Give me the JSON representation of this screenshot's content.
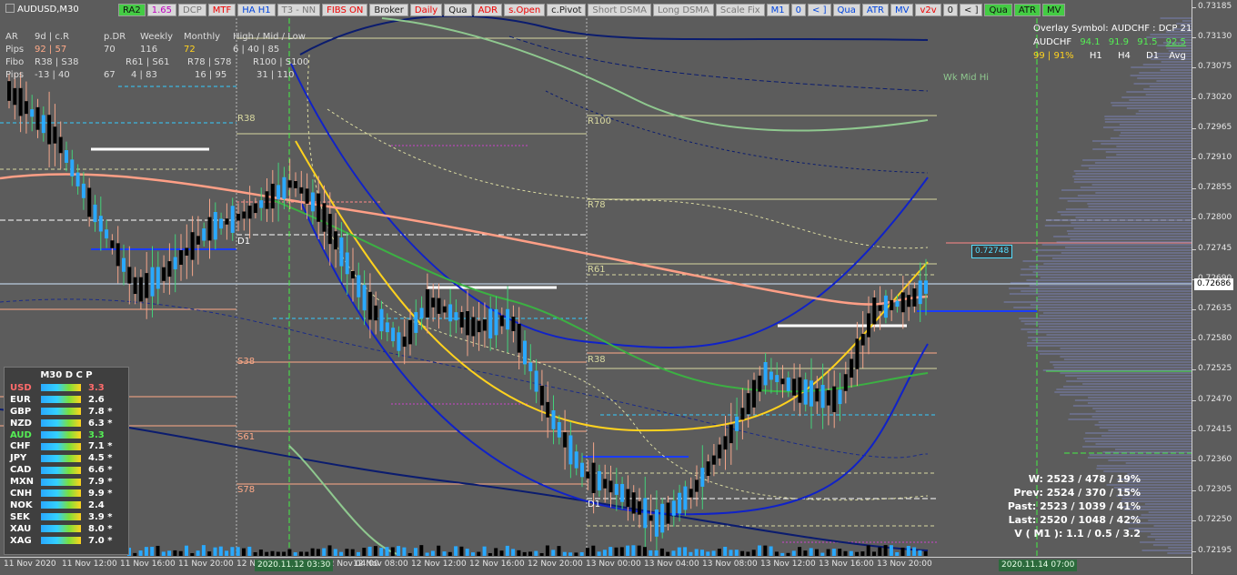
{
  "symbol": "AUDUSD,M30",
  "toolbar": [
    {
      "label": "RA2",
      "cls": "green"
    },
    {
      "label": "1.65",
      "cls": "magenta"
    },
    {
      "label": "DCP",
      "cls": "gray"
    },
    {
      "label": "MTF",
      "cls": "red"
    },
    {
      "label": "HA H1",
      "cls": "blue"
    },
    {
      "label": "T3 - NN",
      "cls": "gray"
    },
    {
      "label": "FIBS ON",
      "cls": "red"
    },
    {
      "label": "Broker",
      "cls": ""
    },
    {
      "label": "Daily",
      "cls": "red"
    },
    {
      "label": "Qua",
      "cls": ""
    },
    {
      "label": "ADR",
      "cls": "red"
    },
    {
      "label": "s.Open",
      "cls": "red"
    },
    {
      "label": "c.Pivot",
      "cls": ""
    },
    {
      "label": "Short DSMA",
      "cls": "gray"
    },
    {
      "label": "Long DSMA",
      "cls": "gray"
    },
    {
      "label": "Scale Fix",
      "cls": "gray"
    },
    {
      "label": "M1",
      "cls": "blue"
    },
    {
      "label": "0",
      "cls": "blue"
    },
    {
      "label": "< ]",
      "cls": "blue"
    },
    {
      "label": "Qua",
      "cls": "blue"
    },
    {
      "label": "ATR",
      "cls": "blue"
    },
    {
      "label": "MV",
      "cls": "blue"
    },
    {
      "label": "v2v",
      "cls": "red"
    },
    {
      "label": "0",
      "cls": ""
    },
    {
      "label": "< ]",
      "cls": ""
    },
    {
      "label": "Qua",
      "cls": "green"
    },
    {
      "label": "ATR",
      "cls": "green"
    },
    {
      "label": "MV",
      "cls": "green"
    }
  ],
  "stats": {
    "r1": [
      "AR",
      "9d | c.R",
      "p.DR",
      "Weekly",
      "Monthly",
      "High / Mid / Low"
    ],
    "r2": [
      "Pips",
      "92 | 57",
      "70",
      "116",
      "72",
      "6 | 40 | 85"
    ],
    "r3": [
      "Fibo",
      "R38 | S38",
      "R61 | S61",
      "R78 | S78",
      "R100 | S100"
    ],
    "r4": [
      "Pips",
      "-13 | 40",
      "67",
      "4 | 83",
      "16 | 95",
      "31 | 110"
    ]
  },
  "price_ticks": [
    "0.73185",
    "0.73130",
    "0.73075",
    "0.73020",
    "0.72965",
    "0.72910",
    "0.72855",
    "0.72800",
    "0.72745",
    "0.72690",
    "0.72635",
    "0.72580",
    "0.72525",
    "0.72470",
    "0.72415",
    "0.72360",
    "0.72305",
    "0.72250",
    "0.72195"
  ],
  "current_price": "0.72686",
  "level_badge": "0.72748",
  "time_ticks": [
    "11 Nov 2020",
    "11 Nov 12:00",
    "11 Nov 16:00",
    "11 Nov 20:00",
    "12 Nov",
    "12 Nov 04:00",
    "12 Nov 08:00",
    "12 Nov 12:00",
    "12 Nov 16:00",
    "12 Nov 20:00",
    "13 Nov 00:00",
    "13 Nov 04:00",
    "13 Nov 08:00",
    "13 Nov 12:00",
    "13 Nov 16:00",
    "13 Nov 20:00"
  ],
  "time_marker_left": "2020.11.12 03:30",
  "time_marker_right": "2020.11.14 07:00",
  "fib_labels": {
    "r38": "R38",
    "r100": "R100",
    "r78": "R78",
    "r61": "R61",
    "s38_a": "S38",
    "s38_b": "R38",
    "s61": "S61",
    "s78": "S78",
    "d1": "D1",
    "d1b": "D1"
  },
  "wk_mid": "Wk Mid Hi",
  "overlay": {
    "title": "Overlay Symbol: AUDCHF : DCP 21",
    "sym": "AUDCHF",
    "vals": [
      "94.1",
      "91.9",
      "91.5",
      "92.5"
    ],
    "pct": "99 | 91%",
    "tfs": [
      "H1",
      "H4",
      "D1",
      "Avg"
    ]
  },
  "dcp": {
    "title": "M30  D C P",
    "rows": [
      {
        "cur": "USD",
        "val": "3.3",
        "color": "#ff6b6b",
        "vcolor": "#ff6b6b"
      },
      {
        "cur": "EUR",
        "val": "2.6",
        "color": "#ffffff",
        "vcolor": "#ffffff"
      },
      {
        "cur": "GBP",
        "val": "7.8 *",
        "color": "#ffffff",
        "vcolor": "#ffffff"
      },
      {
        "cur": "NZD",
        "val": "6.3 *",
        "color": "#ffffff",
        "vcolor": "#ffffff"
      },
      {
        "cur": "AUD",
        "val": "3.3",
        "color": "#55ee55",
        "vcolor": "#55ee55"
      },
      {
        "cur": "CHF",
        "val": "7.1 *",
        "color": "#ffffff",
        "vcolor": "#ffffff"
      },
      {
        "cur": "JPY",
        "val": "4.5 *",
        "color": "#ffffff",
        "vcolor": "#ffffff"
      },
      {
        "cur": "CAD",
        "val": "6.6 *",
        "color": "#ffffff",
        "vcolor": "#ffffff"
      },
      {
        "cur": "MXN",
        "val": "7.9 *",
        "color": "#ffffff",
        "vcolor": "#ffffff"
      },
      {
        "cur": "CNH",
        "val": "9.9 *",
        "color": "#ffffff",
        "vcolor": "#ffffff"
      },
      {
        "cur": "NOK",
        "val": "2.4",
        "color": "#ffffff",
        "vcolor": "#ffffff"
      },
      {
        "cur": "SEK",
        "val": "3.9 *",
        "color": "#ffffff",
        "vcolor": "#ffffff"
      },
      {
        "cur": "XAU",
        "val": "8.0 *",
        "color": "#ffffff",
        "vcolor": "#ffffff"
      },
      {
        "cur": "XAG",
        "val": "7.0 *",
        "color": "#ffffff",
        "vcolor": "#ffffff"
      }
    ]
  },
  "week_stats": [
    "W: 2523 / 478 / 19%",
    "Prev: 2524 / 370 / 15%",
    "Past: 2523 / 1039 / 41%",
    "Last: 2520 / 1048 / 42%",
    "V ( M1 ): 1.1 / 0.5 / 3.2"
  ],
  "colors": {
    "bull": "#2aa9ff",
    "bear": "#000000",
    "bull_ha": "#43d17a",
    "bear_ha": "#f4a58a",
    "yellow": "#ffd21e",
    "blue": "#1022c8",
    "green": "#3cb043",
    "salmon": "#ff9f86"
  }
}
